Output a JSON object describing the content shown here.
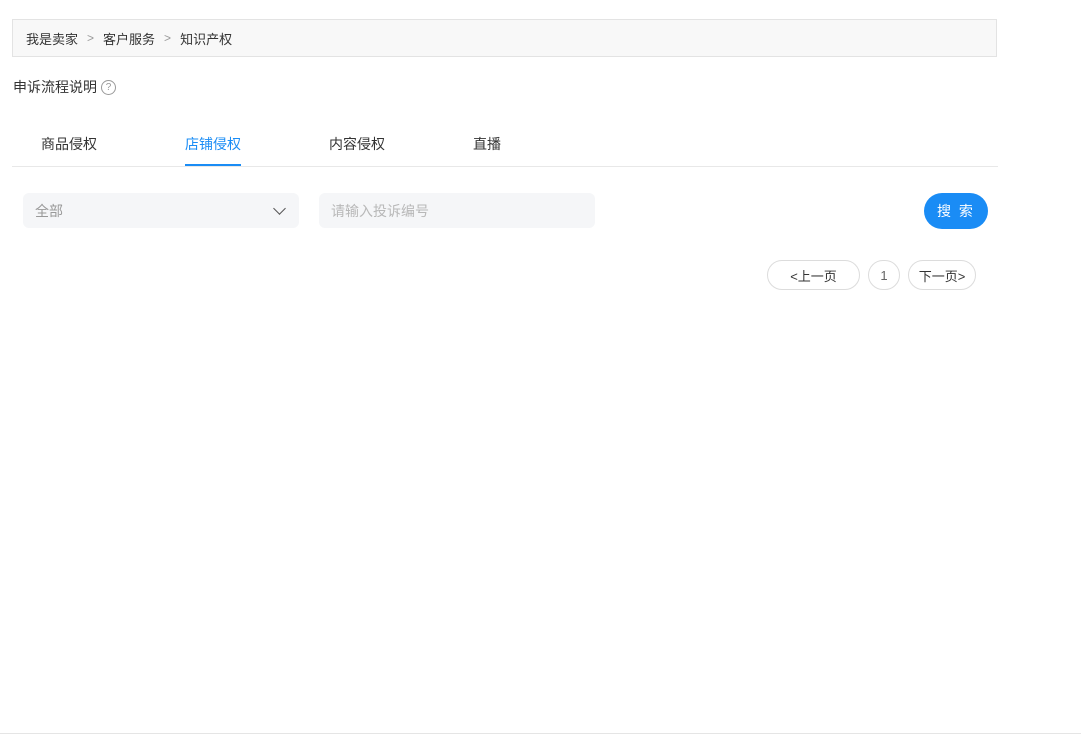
{
  "breadcrumb": {
    "items": [
      "我是卖家",
      "客户服务",
      "知识产权"
    ],
    "separator": ">"
  },
  "appeal": {
    "label": "申诉流程说明",
    "help_glyph": "?",
    "icon": "question-circle-icon"
  },
  "tabs": [
    {
      "label": "商品侵权",
      "active": false
    },
    {
      "label": "店铺侵权",
      "active": true
    },
    {
      "label": "内容侵权",
      "active": false
    },
    {
      "label": "直播",
      "active": false
    }
  ],
  "filter": {
    "type_select": {
      "selected": "全部",
      "icon": "chevron-down-icon"
    },
    "complaint_id_input": {
      "value": "",
      "placeholder": "请输入投诉编号"
    },
    "search_label": "搜 索"
  },
  "pagination": {
    "prev_label": "<上一页",
    "current_page": "1",
    "next_label": "下一页>"
  },
  "colors": {
    "accent": "#1a8cf5",
    "breadcrumb_bg": "#f8f8f8",
    "input_bg": "#f5f6f8"
  }
}
